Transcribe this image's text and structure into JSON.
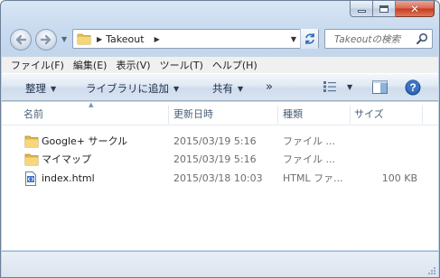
{
  "window": {
    "minimize_label": "",
    "maximize_label": "",
    "close_label": "✕"
  },
  "nav": {
    "back_icon": "back-arrow-icon",
    "forward_icon": "forward-arrow-icon"
  },
  "address": {
    "folder": "Takeout"
  },
  "search": {
    "placeholder": "Takeoutの検索"
  },
  "menu": {
    "items": [
      "ファイル(F)",
      "編集(E)",
      "表示(V)",
      "ツール(T)",
      "ヘルプ(H)"
    ]
  },
  "toolbar": {
    "organize": "整理",
    "add_to_library": "ライブラリに追加",
    "share": "共有",
    "more": "»"
  },
  "columns": {
    "name": "名前",
    "modified": "更新日時",
    "type": "種類",
    "size": "サイズ"
  },
  "files": [
    {
      "name": "Google+ サークル",
      "modified": "2015/03/19 5:16",
      "type": "ファイル ...",
      "size": "",
      "icon": "folder-icon"
    },
    {
      "name": "マイマップ",
      "modified": "2015/03/19 5:16",
      "type": "ファイル ...",
      "size": "",
      "icon": "folder-icon"
    },
    {
      "name": "index.html",
      "modified": "2015/03/18 10:03",
      "type": "HTML ファ...",
      "size": "100 KB",
      "icon": "html-file-icon"
    }
  ],
  "colors": {
    "frame": "#c9dbef",
    "toolbar_text": "#1f2f4a",
    "header_text": "#4c607a",
    "secondary_text": "#6d6d6d",
    "close_red": "#c7391c",
    "help_blue": "#2f66b5"
  }
}
